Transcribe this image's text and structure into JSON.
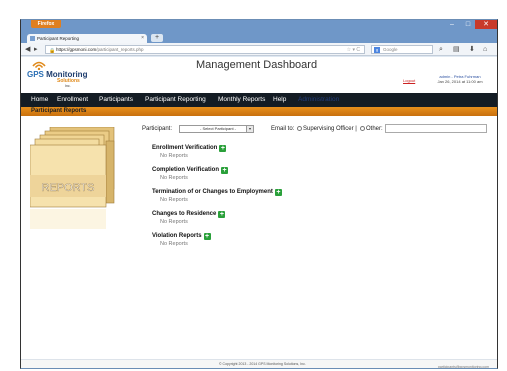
{
  "browser": {
    "menu_button": "Firefox",
    "tab_title": "Participant Reporting",
    "new_tab": "+",
    "url_host": "https://gpsmoni.com",
    "url_path": "/participant_reports.php",
    "search_placeholder": "Google",
    "controls": {
      "minimize": "–",
      "maximize": "□",
      "close": "✕"
    }
  },
  "header": {
    "logo_line1_gps": "GPS",
    "logo_line1_rest": " Monitoring",
    "logo_line2": "Solutions",
    "logo_line3": "Inc.",
    "page_title": "Management Dashboard",
    "logout": "Logout",
    "user_line1": "admin - Petra Fuhrman",
    "user_line2": "Jan 26, 2014 at 11:00 am"
  },
  "menu": {
    "items": [
      "Home",
      "Enrollment",
      "Participants",
      "Participant Reporting",
      "Monthly Reports",
      "Help",
      "Administration"
    ]
  },
  "subheader": {
    "title": "Participant Reports"
  },
  "filters": {
    "participant_label": "Participant:",
    "participant_value": "- Select Participant -",
    "email_label": "Email to:",
    "option_officer": "Supervising Officer |",
    "option_other": "Other:"
  },
  "sections": [
    {
      "title": "Enrollment Verification",
      "empty": "No Reports"
    },
    {
      "title": "Completion Verification",
      "empty": "No Reports"
    },
    {
      "title": "Termination of or Changes to Employment",
      "empty": "No Reports"
    },
    {
      "title": "Changes to Residence",
      "empty": "No Reports"
    },
    {
      "title": "Violation Reports",
      "empty": "No Reports"
    }
  ],
  "art": {
    "label": "REPORTS"
  },
  "footer": {
    "copyright": "© Copyright 2013 - 2014 GPS Monitoring Solutions, Inc.",
    "email": "participants@gpsmonitoring.com"
  },
  "colors": {
    "accent": "#e08a1b",
    "menubar": "#141c24",
    "plus": "#2aa03a"
  }
}
